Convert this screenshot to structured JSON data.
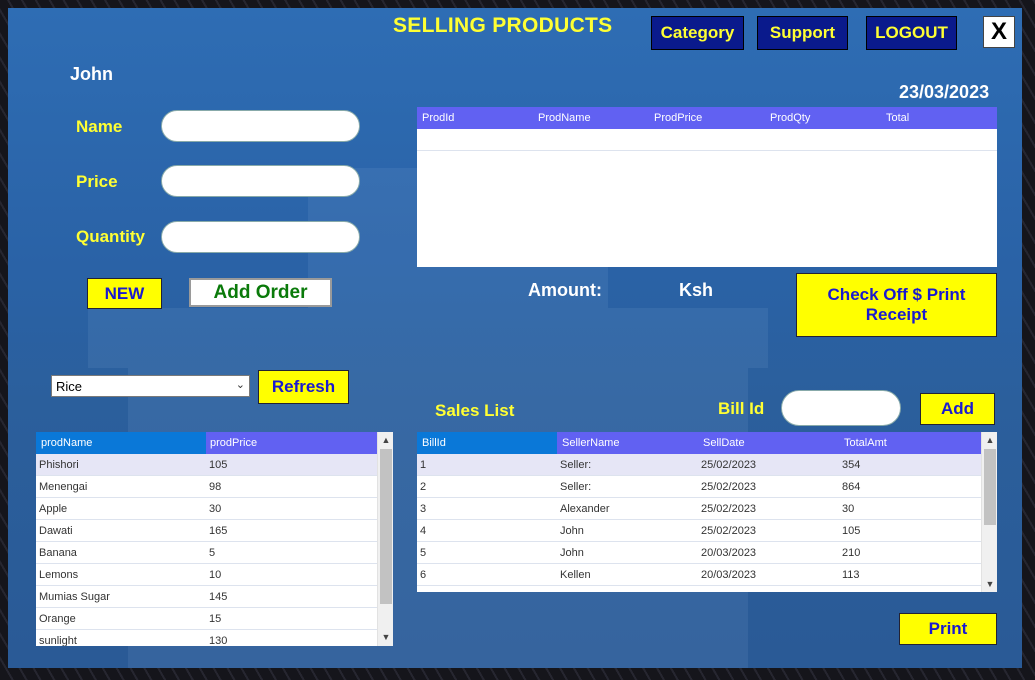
{
  "header": {
    "title": "SELLING PRODUCTS",
    "nav": {
      "category": "Category",
      "support": "Support",
      "logout": "LOGOUT"
    },
    "close": "X",
    "user": "John",
    "date": "23/03/2023"
  },
  "form": {
    "name_label": "Name",
    "price_label": "Price",
    "quantity_label": "Quantity",
    "name_value": "",
    "price_value": "",
    "quantity_value": "",
    "new_label": "NEW",
    "add_order_label": "Add Order"
  },
  "order_grid": {
    "columns": [
      "ProdId",
      "ProdName",
      "ProdPrice",
      "ProdQty",
      "Total"
    ],
    "rows": []
  },
  "amount": {
    "label": "Amount:",
    "currency": "Ksh"
  },
  "checkout_label": "Check Off $ Print Receipt",
  "category_filter": {
    "selected": "Rice",
    "refresh_label": "Refresh"
  },
  "products_grid": {
    "columns": [
      "prodName",
      "prodPrice"
    ],
    "rows": [
      [
        "Phishori",
        "105"
      ],
      [
        "Menengai",
        "98"
      ],
      [
        "Apple",
        "30"
      ],
      [
        "Dawati",
        "165"
      ],
      [
        "Banana",
        "5"
      ],
      [
        "Lemons",
        "10"
      ],
      [
        "Mumias Sugar",
        "145"
      ],
      [
        "Orange",
        "15"
      ],
      [
        "sunlight",
        "130"
      ]
    ]
  },
  "sales": {
    "title": "Sales List",
    "bill_id_label": "Bill Id",
    "bill_id_value": "",
    "add_label": "Add",
    "columns": [
      "BillId",
      "SellerName",
      "SellDate",
      "TotalAmt"
    ],
    "rows": [
      [
        "1",
        "Seller:",
        "25/02/2023",
        "354"
      ],
      [
        "2",
        "Seller:",
        "25/02/2023",
        "864"
      ],
      [
        "3",
        "Alexander",
        "25/02/2023",
        "30"
      ],
      [
        "4",
        "John",
        "25/02/2023",
        "105"
      ],
      [
        "5",
        "John",
        "20/03/2023",
        "210"
      ],
      [
        "6",
        "Kellen",
        "20/03/2023",
        "113"
      ]
    ],
    "print_label": "Print"
  },
  "colors": {
    "accent_yellow": "#ffff00",
    "nav_blue": "#0a1a8c",
    "grid_header": "#6161f2",
    "panel_blue": "#2e6db4"
  }
}
